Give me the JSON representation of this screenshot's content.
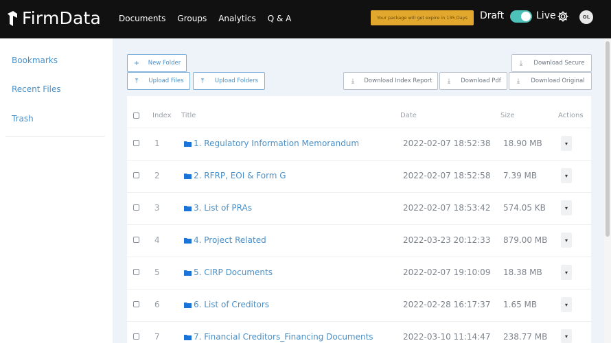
{
  "brand": {
    "name": "FirmData"
  },
  "nav": {
    "items": [
      "Documents",
      "Groups",
      "Analytics",
      "Q & A"
    ]
  },
  "notice": "Your package will get expire in 135 Days",
  "mode": {
    "draft": "Draft",
    "live": "Live",
    "toggle_on": true
  },
  "user": {
    "initials": "OL"
  },
  "sidebar": {
    "items": [
      "Bookmarks",
      "Recent Files",
      "Trash"
    ]
  },
  "toolbar": {
    "new_folder": "New Folder",
    "upload_files": "Upload Files",
    "upload_folders": "Upload Folders",
    "download_secure": "Download Secure",
    "download_index_report": "Download Index Report",
    "download_pdf": "Download Pdf",
    "download_original": "Download Original"
  },
  "table": {
    "headers": {
      "index": "Index",
      "title": "Title",
      "date": "Date",
      "size": "Size",
      "actions": "Actions"
    },
    "rows": [
      {
        "index": "1",
        "title": "1. Regulatory Information Memorandum",
        "date": "2022-02-07 18:52:38",
        "size": "18.90 MB"
      },
      {
        "index": "2",
        "title": "2. RFRP, EOI & Form G",
        "date": "2022-02-07 18:52:58",
        "size": "7.39 MB"
      },
      {
        "index": "3",
        "title": "3. List of PRAs",
        "date": "2022-02-07 18:53:42",
        "size": "574.05 KB"
      },
      {
        "index": "4",
        "title": "4. Project Related",
        "date": "2022-03-23 20:12:33",
        "size": "879.00 MB"
      },
      {
        "index": "5",
        "title": "5. CIRP Documents",
        "date": "2022-02-07 19:10:09",
        "size": "18.38 MB"
      },
      {
        "index": "6",
        "title": "6. List of Creditors",
        "date": "2022-02-28 16:17:37",
        "size": "1.65 MB"
      },
      {
        "index": "7",
        "title": "7. Financial Creditors_Financing Documents",
        "date": "2022-03-10 11:14:47",
        "size": "238.77 MB"
      }
    ]
  },
  "colors": {
    "topbar": "#111111",
    "accent": "#4a90c8",
    "toggle": "#4cc2b8",
    "notice": "#e2a82e",
    "main_bg": "#eef3f9"
  }
}
